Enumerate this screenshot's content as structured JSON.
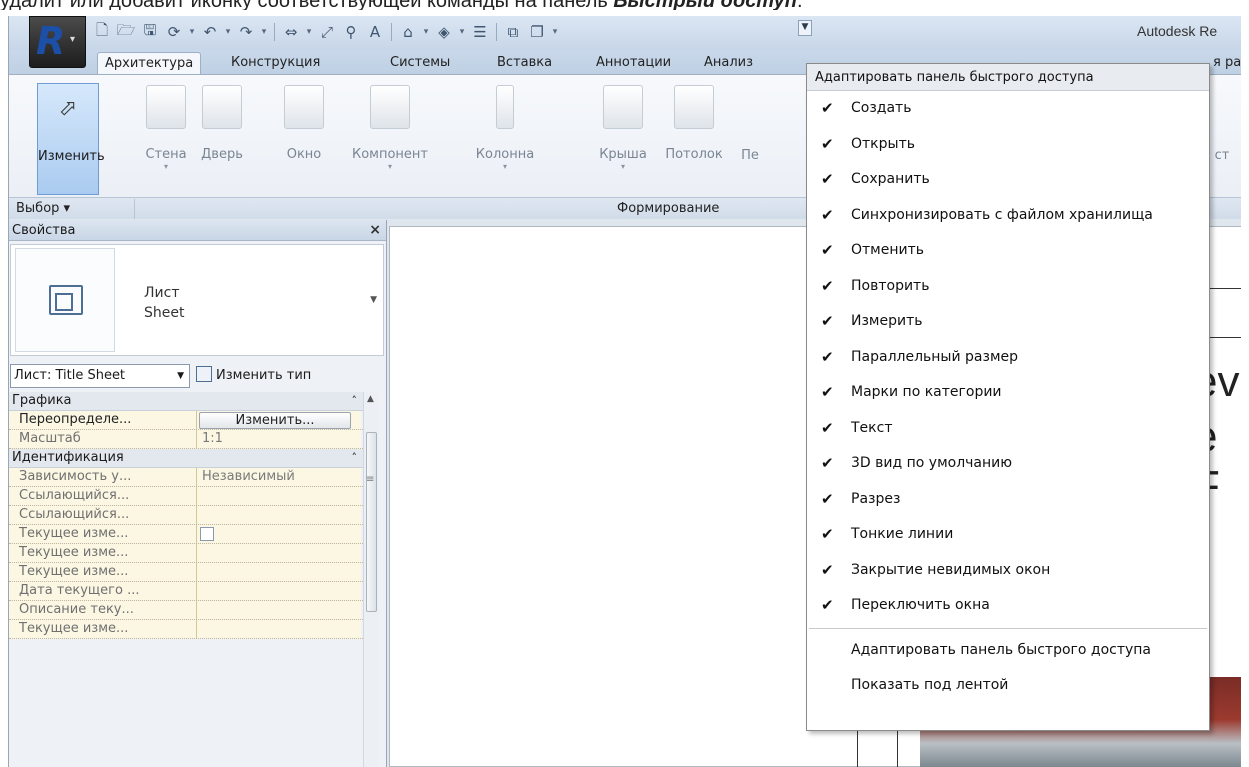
{
  "caption": {
    "text": "удалит или добавит иконку соответствующей команды на панель ",
    "bold": "Быстрый доступ",
    "tail": "."
  },
  "titlebar": {
    "app_title": "Autodesk Re",
    "customize_glyph": "▼"
  },
  "tabs": [
    "Архитектура",
    "Конструкция",
    "Системы",
    "Вставка",
    "Аннотации",
    "Анализ"
  ],
  "tabs_overflow": "я раб",
  "ribbon": {
    "tools": [
      {
        "label": "Изменить"
      },
      {
        "label": "Стена"
      },
      {
        "label": "Дверь"
      },
      {
        "label": "Окно"
      },
      {
        "label": "Компонент"
      },
      {
        "label": "Колонна"
      },
      {
        "label": "Крыша"
      },
      {
        "label": "Потолок"
      },
      {
        "label": "Пе"
      }
    ],
    "right_fragment": "ст",
    "panel_select": "Выбор ▾",
    "panel_form": "Формирование"
  },
  "properties": {
    "title": "Свойства",
    "close": "×",
    "type_name_1": "Лист",
    "type_name_2": "Sheet",
    "selector": "Лист: Title Sheet",
    "edit_type": "Изменить тип",
    "groups": {
      "graphics": "Графика",
      "identity": "Идентификация"
    },
    "rows": {
      "override_key": "Переопределе...",
      "override_btn": "Изменить...",
      "scale_key": "Масштаб",
      "scale_val": "1:1",
      "dependency_key": "Зависимость у...",
      "dependency_val": "Независимый",
      "ref1_key": "Ссылающийся...",
      "ref2_key": "Ссылающийся...",
      "cur1_key": "Текущее изме...",
      "cur2_key": "Текущее изме...",
      "cur3_key": "Текущее изме...",
      "date_key": "Дата текущего ...",
      "desc_key": "Описание теку...",
      "cur4_key": "Текущее изме..."
    }
  },
  "canvas": {
    "text1": "evi",
    "text2": "e F"
  },
  "menu": {
    "header": "Адаптировать панель быстрого доступа",
    "check_glyph": "✔",
    "items": [
      "Создать",
      "Открыть",
      "Сохранить",
      "Синхронизировать с файлом хранилища",
      "Отменить",
      "Повторить",
      "Измерить",
      "Параллельный размер",
      "Марки по категории",
      "Текст",
      "3D вид по умолчанию",
      "Разрез",
      "Тонкие линии",
      "Закрытие невидимых окон",
      "Переключить окна"
    ],
    "footer": [
      "Адаптировать панель быстрого доступа",
      "Показать под лентой"
    ]
  }
}
